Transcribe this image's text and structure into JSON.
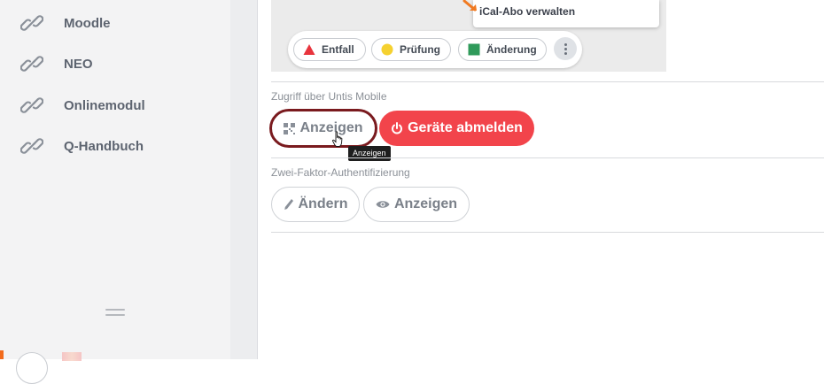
{
  "sidebar": {
    "items": [
      {
        "label": "Moodle",
        "icon": "link-icon"
      },
      {
        "label": "NEO",
        "icon": "link-icon"
      },
      {
        "label": "Onlinemodul",
        "icon": "link-icon"
      },
      {
        "label": "Q-Handbuch",
        "icon": "link-icon"
      }
    ],
    "handle_icon": "drag-handle-icon"
  },
  "preview": {
    "popup_label": "iCal-Abo verwalten",
    "legend": [
      {
        "label": "Entfall",
        "marker": "red-triangle",
        "color": "#e8343d"
      },
      {
        "label": "Prüfung",
        "marker": "yellow-circle",
        "color": "#f5d130"
      },
      {
        "label": "Änderung",
        "marker": "green-square",
        "color": "#2f9a5a"
      }
    ],
    "more_icon": "more-vertical-icon"
  },
  "untis": {
    "section_label": "Zugriff über Untis Mobile",
    "show_button": "Anzeigen",
    "logout_button": "Geräte abmelden",
    "tooltip": "Anzeigen"
  },
  "twofa": {
    "section_label": "Zwei-Faktor-Authentifizierung",
    "change_button": "Ändern",
    "show_button": "Anzeigen"
  },
  "colors": {
    "accent_red": "#f2444b",
    "highlight_ring": "#7a1a1e",
    "sidebar_bg": "#f3f3f4"
  }
}
